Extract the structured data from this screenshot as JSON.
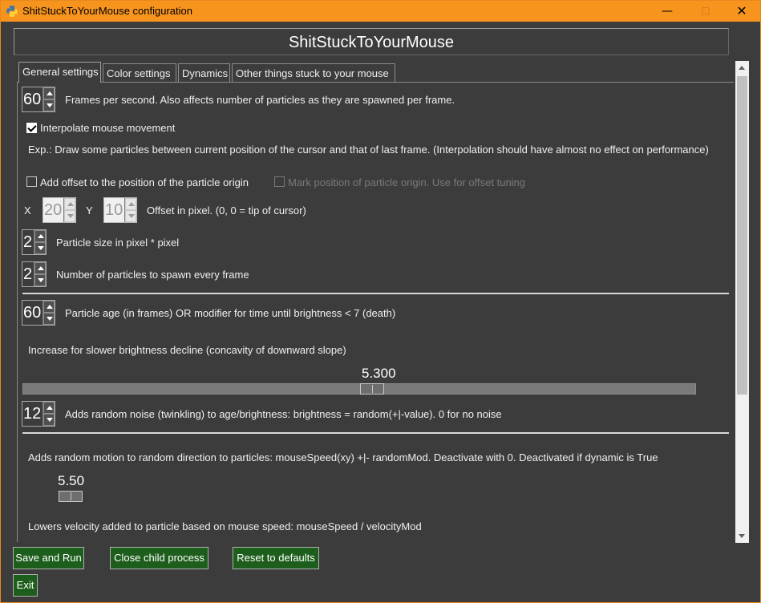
{
  "window": {
    "title": "ShitStuckToYourMouse configuration",
    "minimize_glyph": "—",
    "maximize_glyph": "☐",
    "close_glyph": "✕"
  },
  "header": {
    "title": "ShitStuckToYourMouse"
  },
  "tabs": [
    {
      "label": "General settings",
      "active": true
    },
    {
      "label": "Color settings",
      "active": false
    },
    {
      "label": "Dynamics",
      "active": false
    },
    {
      "label": "Other things stuck to your mouse",
      "active": false
    }
  ],
  "general": {
    "fps": {
      "value": "60",
      "label": "Frames per second. Also affects number of particles as they are spawned per frame."
    },
    "interpolate": {
      "checked": true,
      "label": "Interpolate mouse movement",
      "explanation": "Exp.: Draw some particles between current position of the cursor and that of last frame. (Interpolation should have almost no effect on performance)"
    },
    "offset": {
      "checked": false,
      "label": "Add offset to the position of the particle origin"
    },
    "mark_origin": {
      "checked": false,
      "enabled": false,
      "label": "Mark position of particle origin. Use for offset tuning"
    },
    "offset_x": {
      "axis_label": "X",
      "value": "20",
      "enabled": false
    },
    "offset_y": {
      "axis_label": "Y",
      "value": "10",
      "enabled": false
    },
    "offset_label": "Offset in pixel. (0, 0 = tip of cursor)",
    "particle_size": {
      "value": "2",
      "label": "Particle size in pixel * pixel"
    },
    "particles_per_frame": {
      "value": "2",
      "label": "Number of particles to spawn every frame"
    },
    "particle_age": {
      "value": "60",
      "label": "Particle age (in frames) OR modifier for time until brightness < 7 (death)"
    },
    "brightness_decline": {
      "label": "Increase for slower brightness decline (concavity of downward slope)",
      "value_text": "5.300",
      "fraction": 0.52
    },
    "noise": {
      "value": "12",
      "label": "Adds random noise (twinkling) to age/brightness: brightness = random(+|-value). 0 for no noise"
    },
    "random_motion": {
      "label": "Adds random motion to random direction to particles: mouseSpeed(xy) +|- randomMod. Deactivate with 0. Deactivated if dynamic is True",
      "value_text": "5.50"
    },
    "velocity": {
      "label": "Lowers velocity added to particle based on mouse speed: mouseSpeed / velocityMod"
    }
  },
  "buttons": {
    "save": "Save and Run",
    "close_child": "Close child process",
    "reset": "Reset to defaults",
    "exit": "Exit"
  },
  "colors": {
    "title_bar": "#f7941d",
    "background": "#3c3c3c",
    "button": "#1d5e1d"
  },
  "icons": {
    "app": "python-logo-icon",
    "spin_up": "arrow-up-icon",
    "spin_down": "arrow-down-icon",
    "check": "checkmark-icon"
  }
}
